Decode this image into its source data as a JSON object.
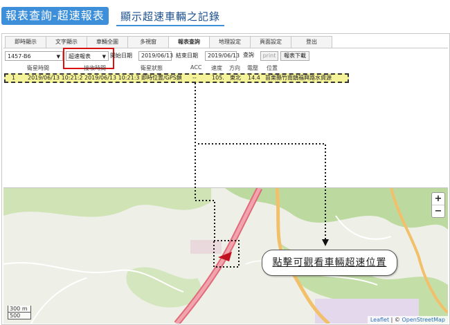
{
  "header": {
    "title": "報表查詢-超速報表",
    "subtitle": "顯示超速車輛之記錄"
  },
  "tabs": [
    {
      "label": "即時顯示",
      "active": false
    },
    {
      "label": "文字顯示",
      "active": false
    },
    {
      "label": "車輛全圖",
      "active": false
    },
    {
      "label": "多視窗",
      "active": false
    },
    {
      "label": "報表查詢",
      "active": true
    },
    {
      "label": "地理設定",
      "active": false
    },
    {
      "label": "頁面設定",
      "active": false
    },
    {
      "label": "登出",
      "active": false
    }
  ],
  "toolbar": {
    "vehicle": "1457-B6",
    "report_type": "超速報表",
    "start_label": "開始日期",
    "start_date": "2019/06/13",
    "end_label": "結束日期",
    "end_date": "2019/06/13",
    "query_label": "查詢",
    "print_label": "print",
    "download_label": "報表下載"
  },
  "table": {
    "headers": [
      "衛星時間",
      "接收時間",
      "衛星狀態",
      "ACC",
      "速度",
      "方向",
      "電壓",
      "位置"
    ],
    "rows": [
      {
        "index": "1",
        "sat_time": "2019/06/13 10:21:2",
        "recv_time": "2019/06/13 10:21:3",
        "status": "即時位置/GPS鎖",
        "acc": "--",
        "speed": "105.",
        "direction": "東北",
        "voltage": "14.4",
        "location": "苗栗縣竹南鎮福興路水資源"
      }
    ]
  },
  "map": {
    "zoom_in": "+",
    "zoom_out": "−",
    "scale_m": "300 m",
    "scale_ft": "500",
    "attribution_leaflet": "Leaflet",
    "attribution_sep": "| ©",
    "attribution_osm": "OpenStreetMap",
    "callout": "點擊可觀看車輛超速位置"
  },
  "colors": {
    "header_blue": "#3d8fd9",
    "row_highlight": "#f5f39a",
    "road_red": "#e06a78",
    "road_orange": "#f2c06b",
    "red_box": "#d91010"
  }
}
